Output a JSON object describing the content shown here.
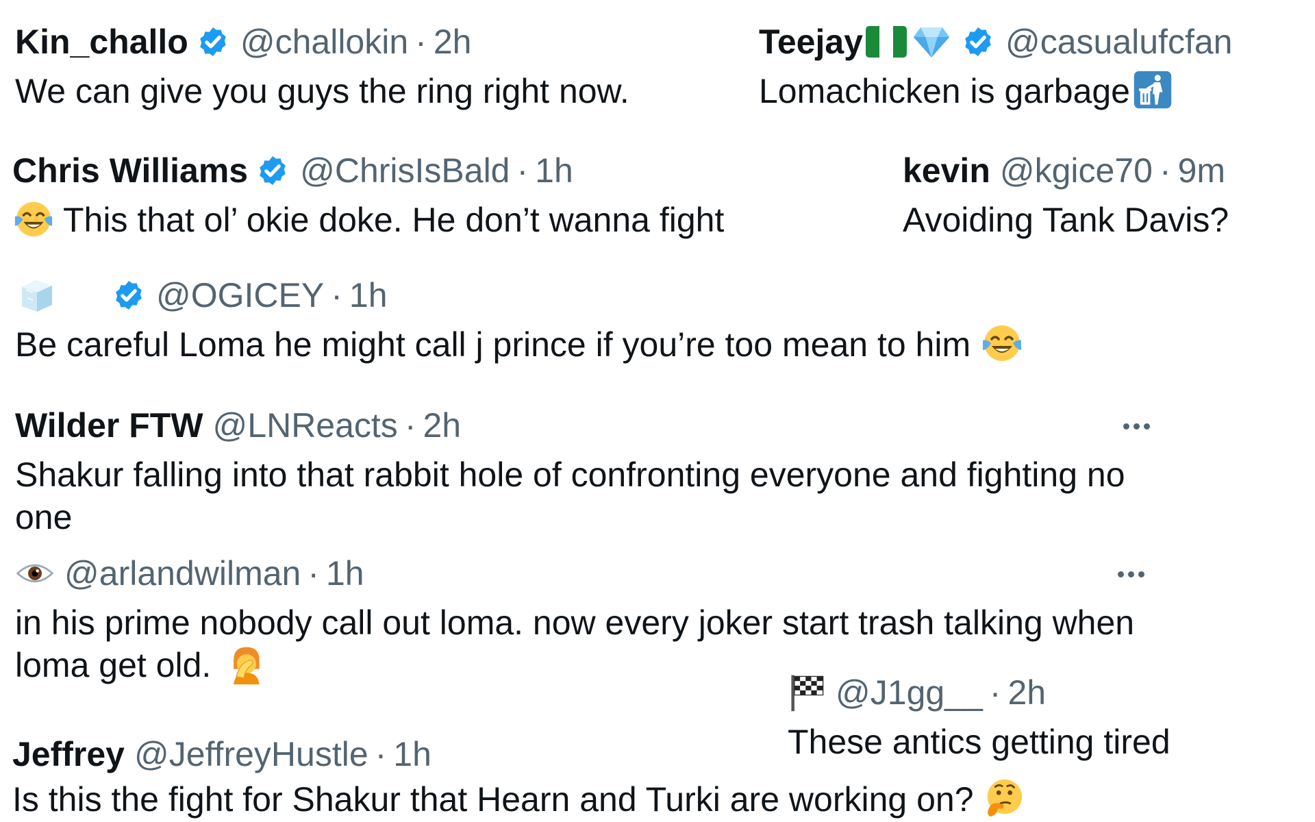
{
  "colors": {
    "text": "#0f1419",
    "secondary": "#536471",
    "verified": "#1d9bf0"
  },
  "tweets": [
    {
      "name": "Kin_challo",
      "verified": true,
      "handle": "@challokin",
      "separator": "·",
      "time": "2h",
      "text": "We can give you guys the ring right now."
    },
    {
      "name": "Teejay",
      "name_emojis": [
        "nigeria-flag-icon",
        "gem-icon"
      ],
      "verified": true,
      "handle": "@casualufcfan",
      "separator": "",
      "time": "",
      "text": "Lomachicken is garbage",
      "text_emoji": "put-litter-in-bin-icon"
    },
    {
      "name": "Chris Williams",
      "verified": true,
      "handle": "@ChrisIsBald",
      "separator": "·",
      "time": "1h",
      "text_emoji_leading": "tears-of-joy-icon",
      "text": "This that ol’ okie doke. He don’t wanna fight"
    },
    {
      "name": "kevin",
      "verified": false,
      "handle": "@kgice70",
      "separator": "·",
      "time": "9m",
      "text": "Avoiding Tank Davis?"
    },
    {
      "name_emoji": "ice-cube-icon",
      "verified": true,
      "handle": "@OGICEY",
      "separator": "·",
      "time": "1h",
      "text": "Be careful Loma he might call j prince if you’re too mean to him",
      "text_emoji": "tears-of-joy-icon"
    },
    {
      "name": "Wilder FTW",
      "verified": false,
      "handle": "@LNReacts",
      "separator": "·",
      "time": "2h",
      "text_line1": "Shakur falling into that rabbit hole of confronting everyone and fighting no",
      "text_line2": "one",
      "more_icon": "more-options-icon"
    },
    {
      "name_emoji": "eye-icon",
      "verified": false,
      "handle": "@arlandwilman",
      "separator": "·",
      "time": "1h",
      "text_line1": "in his prime nobody call out loma. now every joker start trash talking when",
      "text_line2": "loma get old.",
      "text_emoji": "person-facepalming-icon",
      "more_icon": "more-options-icon"
    },
    {
      "name_emoji": "chequered-flag-icon",
      "verified": false,
      "handle": "@J1gg__",
      "separator": "·",
      "time": "2h",
      "text": "These antics getting tired"
    },
    {
      "name": "Jeffrey",
      "verified": false,
      "handle": "@JeffreyHustle",
      "separator": "·",
      "time": "1h",
      "text": "Is this the fight for Shakur that Hearn and Turki are working on?",
      "text_emoji": "thinking-face-icon"
    }
  ]
}
